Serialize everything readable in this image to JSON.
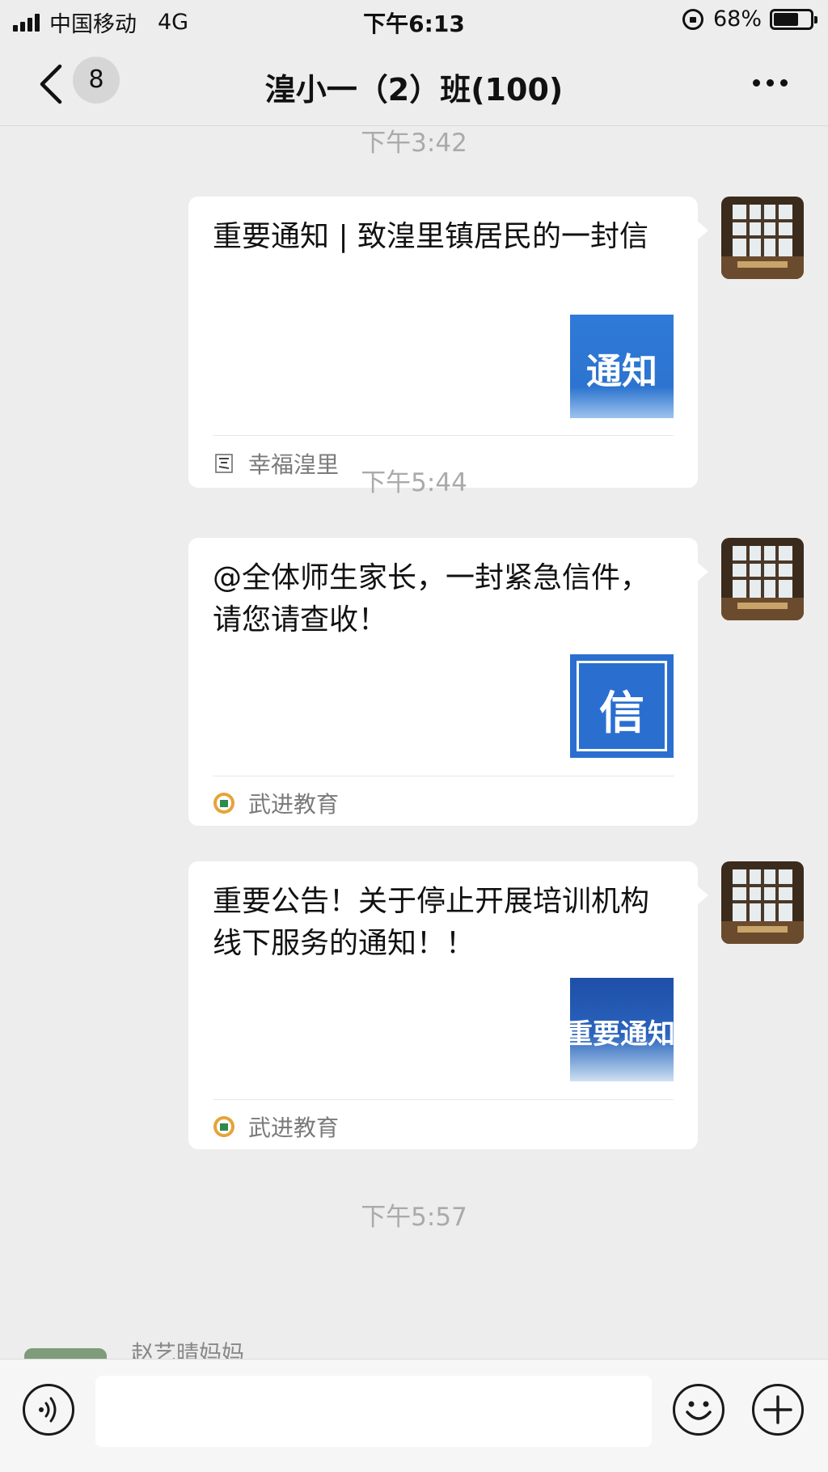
{
  "status_bar": {
    "carrier": "中国移动",
    "network": "4G",
    "time": "下午6:13",
    "battery_percent": "68%",
    "battery_level": 0.68
  },
  "nav": {
    "back_icon": "chevron-left-icon",
    "unread_count": "8",
    "title": "湟小一（2）班(100)",
    "more_icon": "more-dots-icon"
  },
  "chat": {
    "time_labels": [
      "下午3:42",
      "下午5:44",
      "下午5:57"
    ],
    "messages": [
      {
        "title": "重要通知 | 致湟里镇居民的一封信",
        "thumbnail_text": "通知",
        "source": "幸福湟里"
      },
      {
        "title": "@全体师生家长，一封紧急信件，请您请查收！",
        "thumbnail_text": "信",
        "source": "武进教育"
      },
      {
        "title": "重要公告！关于停止开展培训机构线下服务的通知！！",
        "thumbnail_text": "重要通知",
        "source": "武进教育"
      }
    ],
    "next_sender_name": "赵艺晴妈妈"
  },
  "input_bar": {
    "voice_icon": "voice-icon",
    "input_value": "",
    "emoji_icon": "emoji-icon",
    "plus_icon": "plus-icon"
  },
  "colors": {
    "background": "#ededed",
    "card": "#ffffff",
    "time_label": "#aaaaaa",
    "thumb_blue": "#2a6fd0"
  }
}
